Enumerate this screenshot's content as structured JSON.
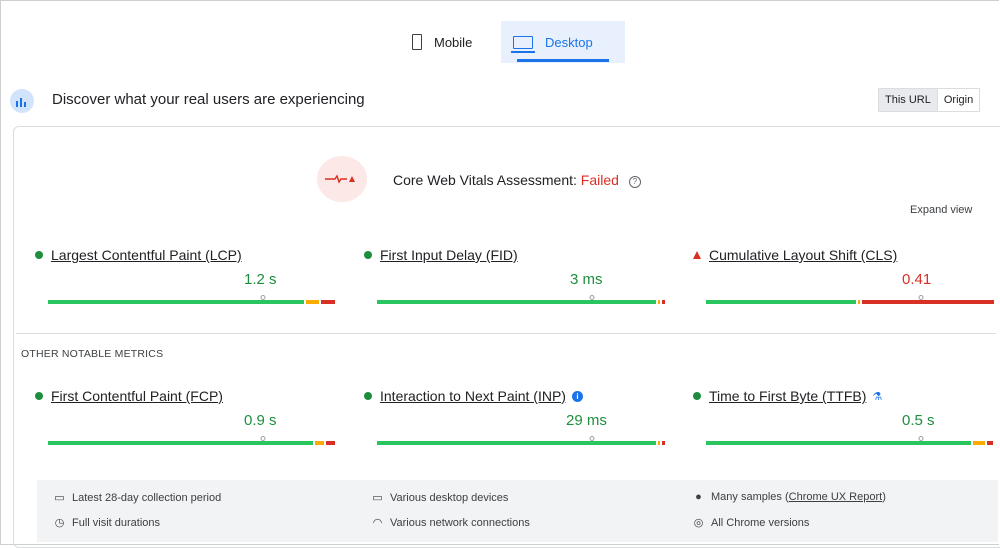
{
  "tabs": [
    {
      "label": "Mobile",
      "icon": "phone-icon",
      "selected": false
    },
    {
      "label": "Desktop",
      "icon": "laptop-icon",
      "selected": true
    }
  ],
  "discover": {
    "text": "Discover what your real users are experiencing",
    "toggle": {
      "this_url": "This URL",
      "origin": "Origin",
      "selected": "This URL"
    }
  },
  "assessment": {
    "label": "Core Web Vitals Assessment:",
    "status": "Failed",
    "status_color": "#d93025",
    "expand_label": "Expand view"
  },
  "core_metrics": [
    {
      "name": "Largest Contentful Paint (LCP)",
      "value": "1.2 s",
      "rating": "good",
      "distribution": {
        "good": 0.9,
        "needs_improvement": 0.05,
        "poor": 0.05
      },
      "percentile_position": 0.75
    },
    {
      "name": "First Input Delay (FID)",
      "value": "3 ms",
      "rating": "good",
      "distribution": {
        "good": 0.98,
        "needs_improvement": 0.01,
        "poor": 0.01
      },
      "percentile_position": 0.75
    },
    {
      "name": "Cumulative Layout Shift (CLS)",
      "value": "0.41",
      "rating": "poor",
      "distribution": {
        "good": 0.53,
        "needs_improvement": 0.01,
        "poor": 0.46
      },
      "percentile_position": 0.75
    }
  ],
  "other_heading": "OTHER NOTABLE METRICS",
  "other_metrics": [
    {
      "name": "First Contentful Paint (FCP)",
      "value": "0.9 s",
      "rating": "good",
      "distribution": {
        "good": 0.93,
        "needs_improvement": 0.04,
        "poor": 0.03
      },
      "percentile_position": 0.75
    },
    {
      "name": "Interaction to Next Paint (INP)",
      "value": "29 ms",
      "rating": "good",
      "distribution": {
        "good": 0.98,
        "needs_improvement": 0.01,
        "poor": 0.01
      },
      "percentile_position": 0.75,
      "badge": "info-icon"
    },
    {
      "name": "Time to First Byte (TTFB)",
      "value": "0.5 s",
      "rating": "good",
      "distribution": {
        "good": 0.93,
        "needs_improvement": 0.05,
        "poor": 0.02
      },
      "percentile_position": 0.75,
      "badge": "flask-icon"
    }
  ],
  "footer": {
    "collection_period": "Latest 28-day collection period",
    "visit_durations": "Full visit durations",
    "devices": "Various desktop devices",
    "network": "Various network connections",
    "samples_prefix": "Many samples (",
    "samples_link": "Chrome UX Report",
    "samples_suffix": ")",
    "chrome_versions": "All Chrome versions"
  },
  "colors": {
    "good": "#1e8e3e",
    "good_bar": "#29c55e",
    "needs_improvement": "#f9ab00",
    "poor": "#d93025",
    "accent": "#1a73e8"
  }
}
